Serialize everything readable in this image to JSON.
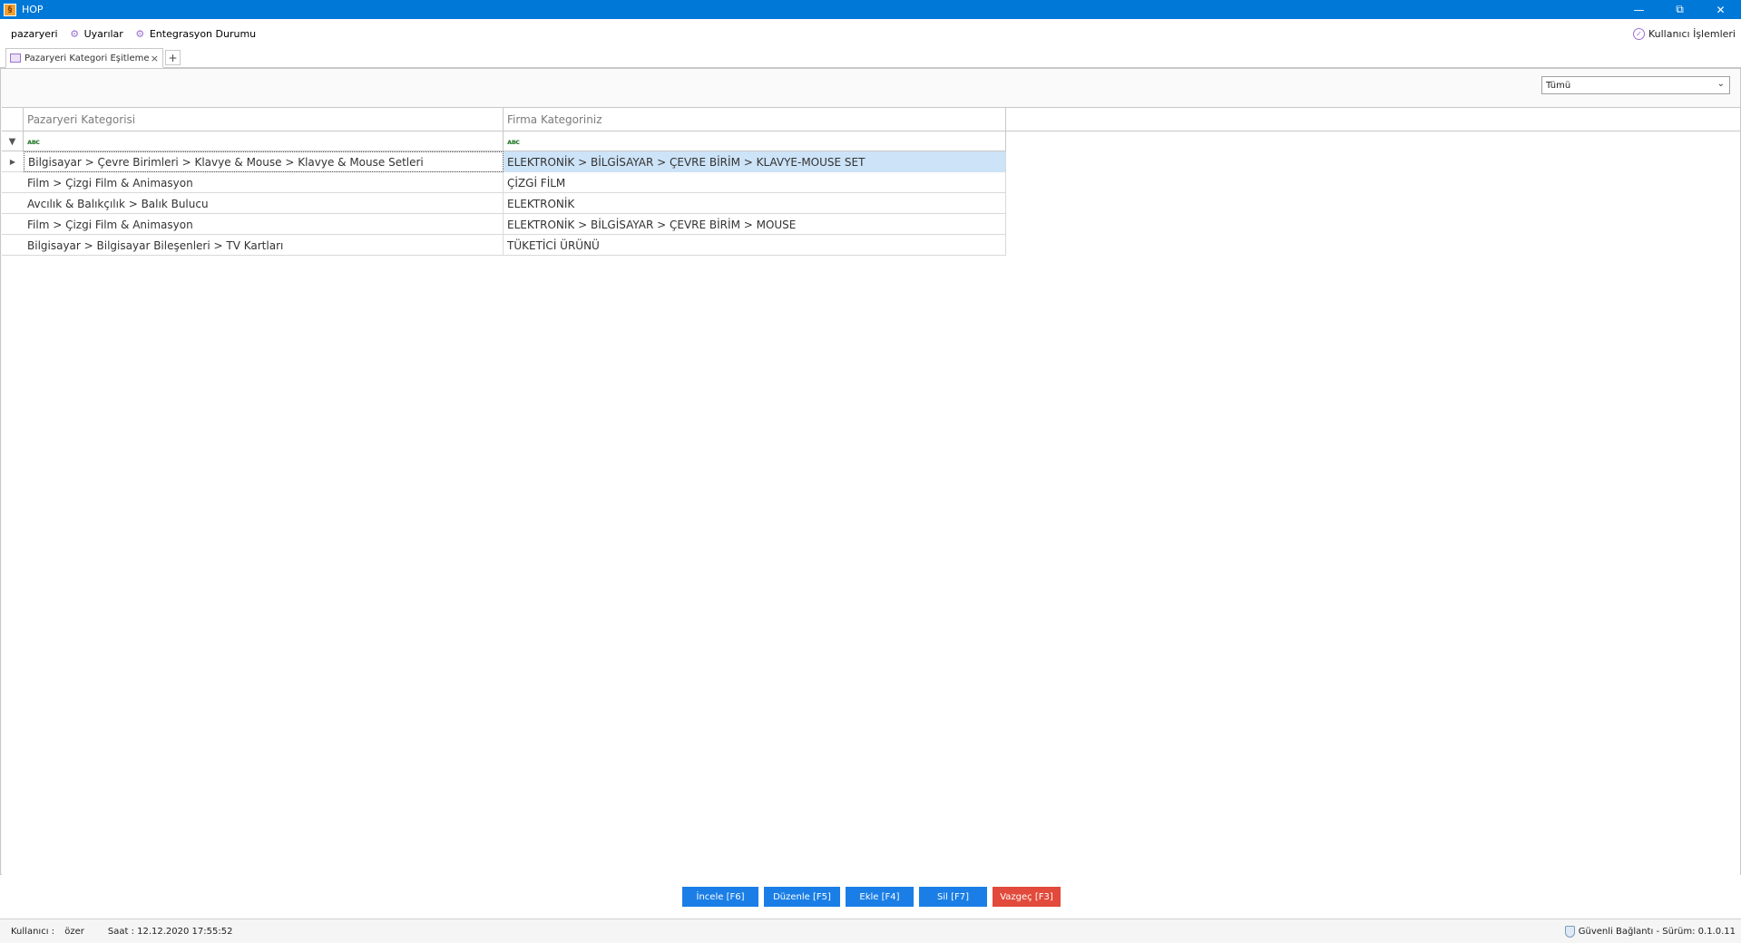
{
  "window": {
    "title": "HOP",
    "app_icon": "hop-app-icon"
  },
  "menu": {
    "items": [
      {
        "label": "pazaryeri",
        "icon": ""
      },
      {
        "label": "Uyarılar",
        "icon": "alerts-icon"
      },
      {
        "label": "Entegrasyon Durumu",
        "icon": "integration-icon"
      }
    ],
    "user_ops": "Kullanıcı İşlemleri"
  },
  "tabs": {
    "active": "Pazaryeri Kategori Eşitleme",
    "add": "+"
  },
  "filter": {
    "selected": "Tümü"
  },
  "grid": {
    "columns": [
      "Pazaryeri Kategorisi",
      "Firma Kategoriniz"
    ],
    "rows": [
      [
        "Bilgisayar > Çevre Birimleri > Klavye & Mouse > Klavye & Mouse Setleri",
        "ELEKTRONİK > BİLGİSAYAR > ÇEVRE BİRİM > KLAVYE-MOUSE SET"
      ],
      [
        "Film > Çizgi Film & Animasyon",
        "ÇİZGİ FİLM"
      ],
      [
        "Avcılık & Balıkçılık > Balık Bulucu",
        "ELEKTRONİK"
      ],
      [
        "Film > Çizgi Film & Animasyon",
        "ELEKTRONİK > BİLGİSAYAR > ÇEVRE BİRİM > MOUSE"
      ],
      [
        "Bilgisayar > Bilgisayar Bileşenleri > TV Kartları",
        "TÜKETİCİ ÜRÜNÜ"
      ]
    ]
  },
  "buttons": {
    "incele": "İncele [F6]",
    "duzenle": "Düzenle [F5]",
    "ekle": "Ekle [F4]",
    "sil": "Sil [F7]",
    "vazgec": "Vazgeç [F3]"
  },
  "status": {
    "user_label": "Kullanıcı :",
    "user_name": "özer",
    "time": "Saat : 12.12.2020 17:55:52",
    "connection": "Güvenli Bağlantı - Sürüm: 0.1.0.11"
  },
  "colors": {
    "titlebar": "#0078d7",
    "button_blue": "#1a7ee6",
    "button_red": "#e24a3b",
    "selection": "#cde3f7"
  }
}
